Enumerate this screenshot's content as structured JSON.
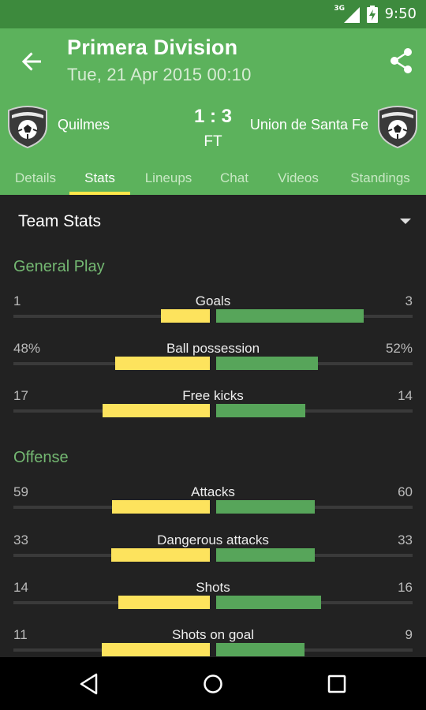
{
  "status_bar": {
    "network": "3G",
    "time": "9:50"
  },
  "toolbar": {
    "title": "Primera Division",
    "subtitle": "Tue, 21 Apr 2015 00:10",
    "back_icon": "arrow-back-icon",
    "share_icon": "share-icon"
  },
  "match": {
    "home_team": "Quilmes",
    "away_team": "Union de Santa Fe",
    "score": "1 : 3",
    "status": "FT"
  },
  "tabs": [
    {
      "label": "Details",
      "active": false
    },
    {
      "label": "Stats",
      "active": true
    },
    {
      "label": "Lineups",
      "active": false
    },
    {
      "label": "Chat",
      "active": false
    },
    {
      "label": "Videos",
      "active": false
    },
    {
      "label": "Standings",
      "active": false
    }
  ],
  "stats_section": {
    "title": "Team Stats",
    "groups": [
      {
        "title": "General Play",
        "stats": [
          {
            "name": "Goals",
            "home": "1",
            "away": "3",
            "home_fill": 0.25,
            "away_fill": 0.75
          },
          {
            "name": "Ball possession",
            "home": "48%",
            "away": "52%",
            "home_fill": 0.48,
            "away_fill": 0.52
          },
          {
            "name": "Free kicks",
            "home": "17",
            "away": "14",
            "home_fill": 0.548,
            "away_fill": 0.452
          }
        ]
      },
      {
        "title": "Offense",
        "stats": [
          {
            "name": "Attacks",
            "home": "59",
            "away": "60",
            "home_fill": 0.496,
            "away_fill": 0.504
          },
          {
            "name": "Dangerous attacks",
            "home": "33",
            "away": "33",
            "home_fill": 0.5,
            "away_fill": 0.5
          },
          {
            "name": "Shots",
            "home": "14",
            "away": "16",
            "home_fill": 0.467,
            "away_fill": 0.533
          },
          {
            "name": "Shots on goal",
            "home": "11",
            "away": "9",
            "home_fill": 0.55,
            "away_fill": 0.45
          }
        ]
      }
    ]
  },
  "colors": {
    "status_bar": "#3d8a3d",
    "toolbar": "#5cb25c",
    "tab_indicator": "#ffe74a",
    "home_bar": "#fde35d",
    "away_bar": "#57a55a",
    "group_title": "#74b872",
    "content_bg": "#222222"
  },
  "navigation": {
    "back": "nav-back-icon",
    "home": "nav-home-icon",
    "recents": "nav-recents-icon"
  }
}
